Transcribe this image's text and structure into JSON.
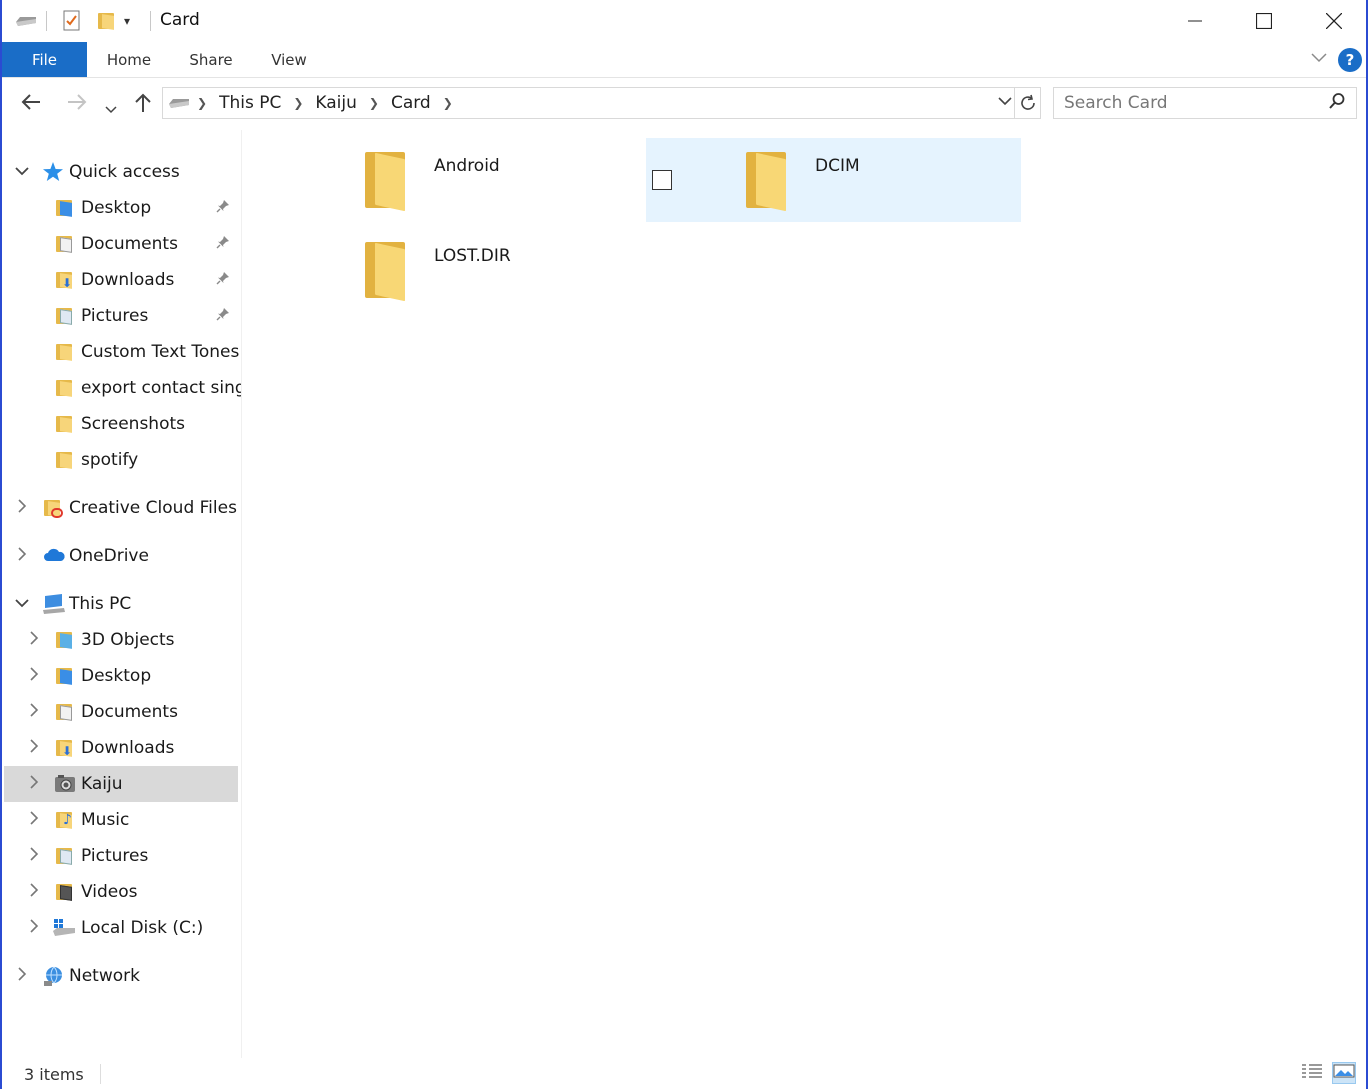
{
  "window": {
    "title": "Card",
    "controls": {
      "minimize": "—",
      "maximize": "☐",
      "close": "✕"
    }
  },
  "ribbon": {
    "tabs": [
      "File",
      "Home",
      "Share",
      "View"
    ],
    "help": "?"
  },
  "navbar": {
    "breadcrumb": [
      "This PC",
      "Kaiju",
      "Card"
    ],
    "search_placeholder": "Search Card"
  },
  "sidebar": {
    "quick_access": {
      "label": "Quick access",
      "items": [
        {
          "label": "Desktop",
          "pinned": true,
          "icon": "desktop-folder-icon"
        },
        {
          "label": "Documents",
          "pinned": true,
          "icon": "documents-folder-icon"
        },
        {
          "label": "Downloads",
          "pinned": true,
          "icon": "downloads-folder-icon"
        },
        {
          "label": "Pictures",
          "pinned": true,
          "icon": "pictures-folder-icon"
        },
        {
          "label": "Custom Text Tones S",
          "pinned": false,
          "icon": "folder-icon"
        },
        {
          "label": "export contact singl",
          "pinned": false,
          "icon": "folder-icon"
        },
        {
          "label": "Screenshots",
          "pinned": false,
          "icon": "folder-icon"
        },
        {
          "label": "spotify",
          "pinned": false,
          "icon": "folder-icon"
        }
      ]
    },
    "creative_cloud": {
      "label": "Creative Cloud Files"
    },
    "onedrive": {
      "label": "OneDrive"
    },
    "this_pc": {
      "label": "This PC",
      "items": [
        {
          "label": "3D Objects",
          "icon": "3d-objects-icon"
        },
        {
          "label": "Desktop",
          "icon": "desktop-folder-icon"
        },
        {
          "label": "Documents",
          "icon": "documents-folder-icon"
        },
        {
          "label": "Downloads",
          "icon": "downloads-folder-icon"
        },
        {
          "label": "Kaiju",
          "icon": "camera-device-icon",
          "selected": true
        },
        {
          "label": "Music",
          "icon": "music-folder-icon"
        },
        {
          "label": "Pictures",
          "icon": "pictures-folder-icon"
        },
        {
          "label": "Videos",
          "icon": "videos-folder-icon"
        },
        {
          "label": "Local Disk (C:)",
          "icon": "local-disk-icon"
        }
      ]
    },
    "network": {
      "label": "Network"
    }
  },
  "content": {
    "folders": [
      {
        "name": "Android",
        "selected": false
      },
      {
        "name": "DCIM",
        "selected": true
      },
      {
        "name": "LOST.DIR",
        "selected": false
      }
    ]
  },
  "status": {
    "item_count": "3 items"
  },
  "colors": {
    "accent": "#1a6dc7",
    "selection": "#e5f3fe",
    "nav_selected": "#d9d9d9",
    "folder": "#f8d775",
    "window_border": "#2b4bd2"
  }
}
